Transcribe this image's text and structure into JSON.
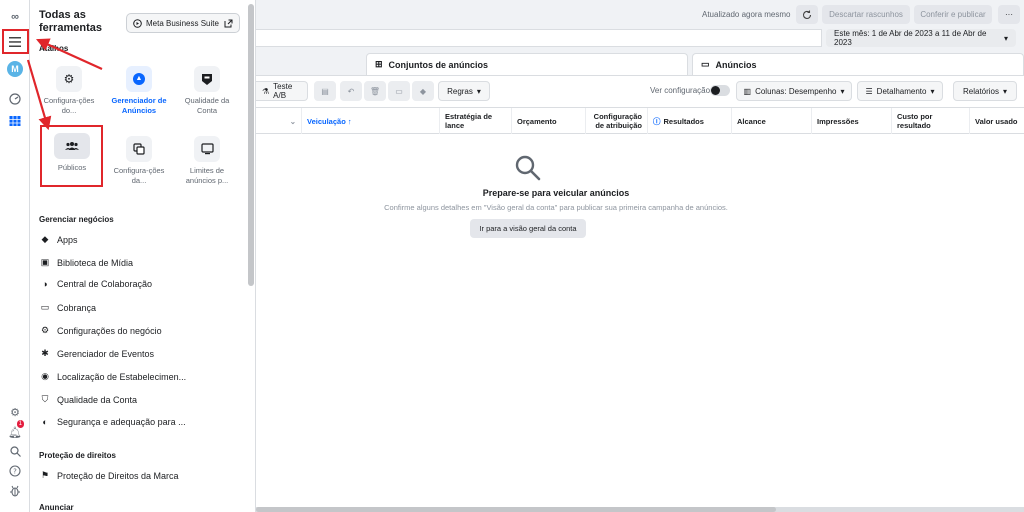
{
  "rail": {
    "logo": "∞",
    "avatar_initial": "M",
    "notification_count": "1"
  },
  "drawer": {
    "title": "Todas as ferramentas",
    "mbs_button": "Meta Business Suite",
    "shortcuts_label": "Atalhos",
    "shortcuts": [
      {
        "label": "Configura-ções do..."
      },
      {
        "label": "Gerenciador de Anúncios"
      },
      {
        "label": "Qualidade da Conta"
      },
      {
        "label": "Públicos"
      },
      {
        "label": "Configura-ções da..."
      },
      {
        "label": "Limites de anúncios p..."
      }
    ],
    "manage_label": "Gerenciar negócios",
    "manage_items": [
      {
        "label": "Apps",
        "icon": "cube-icon"
      },
      {
        "label": "Biblioteca de Mídia",
        "icon": "image-icon"
      },
      {
        "label": "Central de Colaboração",
        "icon": "handshake-icon"
      },
      {
        "label": "Cobrança",
        "icon": "card-icon"
      },
      {
        "label": "Configurações do negócio",
        "icon": "gear-icon"
      },
      {
        "label": "Gerenciador de Eventos",
        "icon": "events-icon"
      },
      {
        "label": "Localização de Estabelecimen...",
        "icon": "location-icon"
      },
      {
        "label": "Qualidade da Conta",
        "icon": "shield-icon"
      },
      {
        "label": "Segurança e adequação para ...",
        "icon": "security-icon"
      }
    ],
    "rights_label": "Proteção de direitos",
    "rights_items": [
      {
        "label": "Proteção de Direitos da Marca",
        "icon": "flag-icon"
      }
    ],
    "advertise_label": "Anunciar"
  },
  "topbar": {
    "updated": "Atualizado agora mesmo",
    "discard": "Descartar rascunhos",
    "review": "Conferir e publicar",
    "more": "···"
  },
  "datebar": {
    "date_range": "Este mês: 1 de Abr de 2023 a 11 de Abr de 2023"
  },
  "tabs": {
    "adsets": "Conjuntos de anúncios",
    "ads": "Anúncios"
  },
  "toolbar": {
    "ab_test": "Teste A/B",
    "rules": "Regras",
    "view_setup": "Ver configuração",
    "columns": "Colunas: Desempenho",
    "breakdown": "Detalhamento",
    "reports": "Relatórios"
  },
  "table": {
    "headers": [
      "Veiculação ↑",
      "Estratégia de lance",
      "Orçamento",
      "Configuração de atribuição",
      "Resultados",
      "Alcance",
      "Impressões",
      "Custo por resultado",
      "Valor usado"
    ]
  },
  "empty": {
    "title": "Prepare-se para veicular anúncios",
    "subtitle": "Confirme alguns detalhes em \"Visão geral da conta\" para publicar sua primeira campanha de anúncios.",
    "button": "Ir para a visão geral da conta"
  },
  "colors": {
    "accent": "#0866ff",
    "annotation": "#e0262b"
  }
}
